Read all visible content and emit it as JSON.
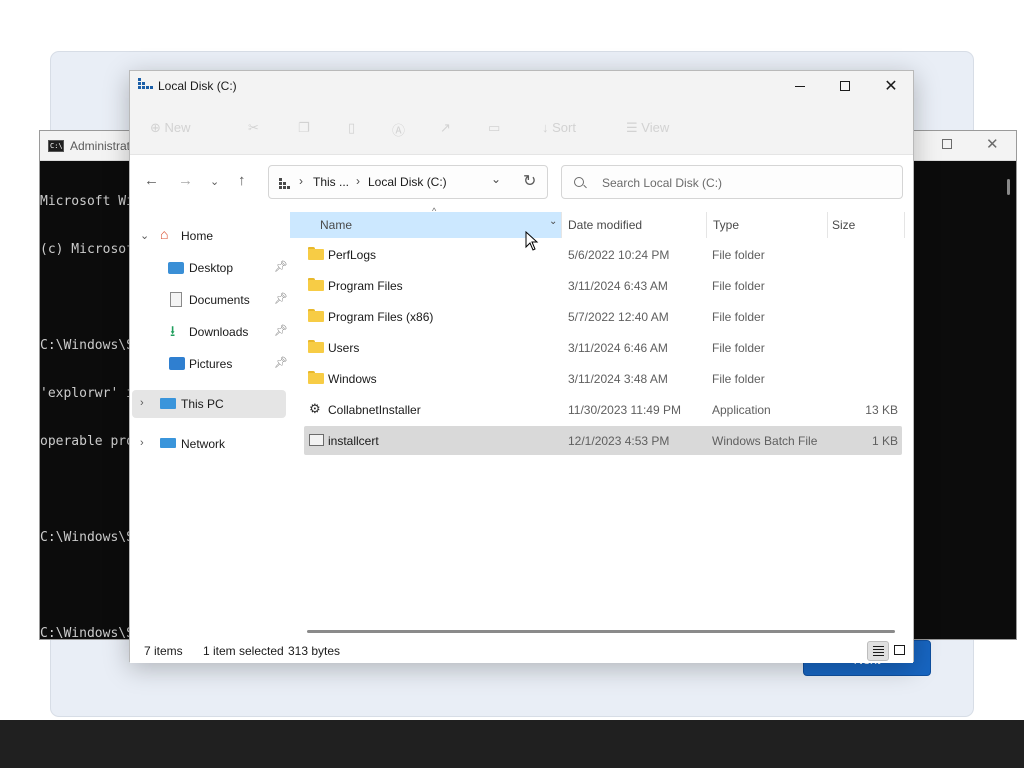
{
  "background_dialog": {
    "button_label": "Next"
  },
  "cmd": {
    "title": "Administrat",
    "lines": [
      "Microsoft Wi",
      "(c) Microsof",
      "",
      "C:\\Windows\\S",
      "'explorwr' i",
      "operable pro",
      "",
      "C:\\Windows\\S",
      "",
      "C:\\Windows\\S"
    ]
  },
  "explorer": {
    "title": "Local Disk (C:)",
    "window_buttons": {
      "minimize": "minimize-icon",
      "maximize": "maximize-icon",
      "close": "close-icon"
    },
    "command_bar": {
      "new": "New",
      "sort": "Sort",
      "view": "View"
    },
    "address": {
      "crumbs": [
        "This ...",
        "Local Disk (C:)"
      ]
    },
    "search": {
      "placeholder": "Search Local Disk (C:)"
    },
    "sidebar": {
      "home": "Home",
      "quick": [
        {
          "label": "Desktop",
          "icon": "desktop-icon"
        },
        {
          "label": "Documents",
          "icon": "documents-icon"
        },
        {
          "label": "Downloads",
          "icon": "downloads-icon"
        },
        {
          "label": "Pictures",
          "icon": "pictures-icon"
        }
      ],
      "this_pc": "This PC",
      "network": "Network"
    },
    "columns": {
      "name": "Name",
      "date": "Date modified",
      "type": "Type",
      "size": "Size"
    },
    "files": [
      {
        "name": "PerfLogs",
        "date": "5/6/2022 10:24 PM",
        "type": "File folder",
        "size": "",
        "icon": "folder-icon"
      },
      {
        "name": "Program Files",
        "date": "3/11/2024 6:43 AM",
        "type": "File folder",
        "size": "",
        "icon": "folder-icon"
      },
      {
        "name": "Program Files (x86)",
        "date": "5/7/2022 12:40 AM",
        "type": "File folder",
        "size": "",
        "icon": "folder-icon"
      },
      {
        "name": "Users",
        "date": "3/11/2024 6:46 AM",
        "type": "File folder",
        "size": "",
        "icon": "folder-icon"
      },
      {
        "name": "Windows",
        "date": "3/11/2024 3:48 AM",
        "type": "File folder",
        "size": "",
        "icon": "folder-icon"
      },
      {
        "name": "CollabnetInstaller",
        "date": "11/30/2023 11:49 PM",
        "type": "Application",
        "size": "13 KB",
        "icon": "application-icon"
      },
      {
        "name": "installcert",
        "date": "12/1/2023 4:53 PM",
        "type": "Windows Batch File",
        "size": "1 KB",
        "icon": "batch-file-icon"
      }
    ],
    "status": {
      "count": "7 items",
      "selected": "1 item selected",
      "bytes": "313 bytes"
    }
  }
}
